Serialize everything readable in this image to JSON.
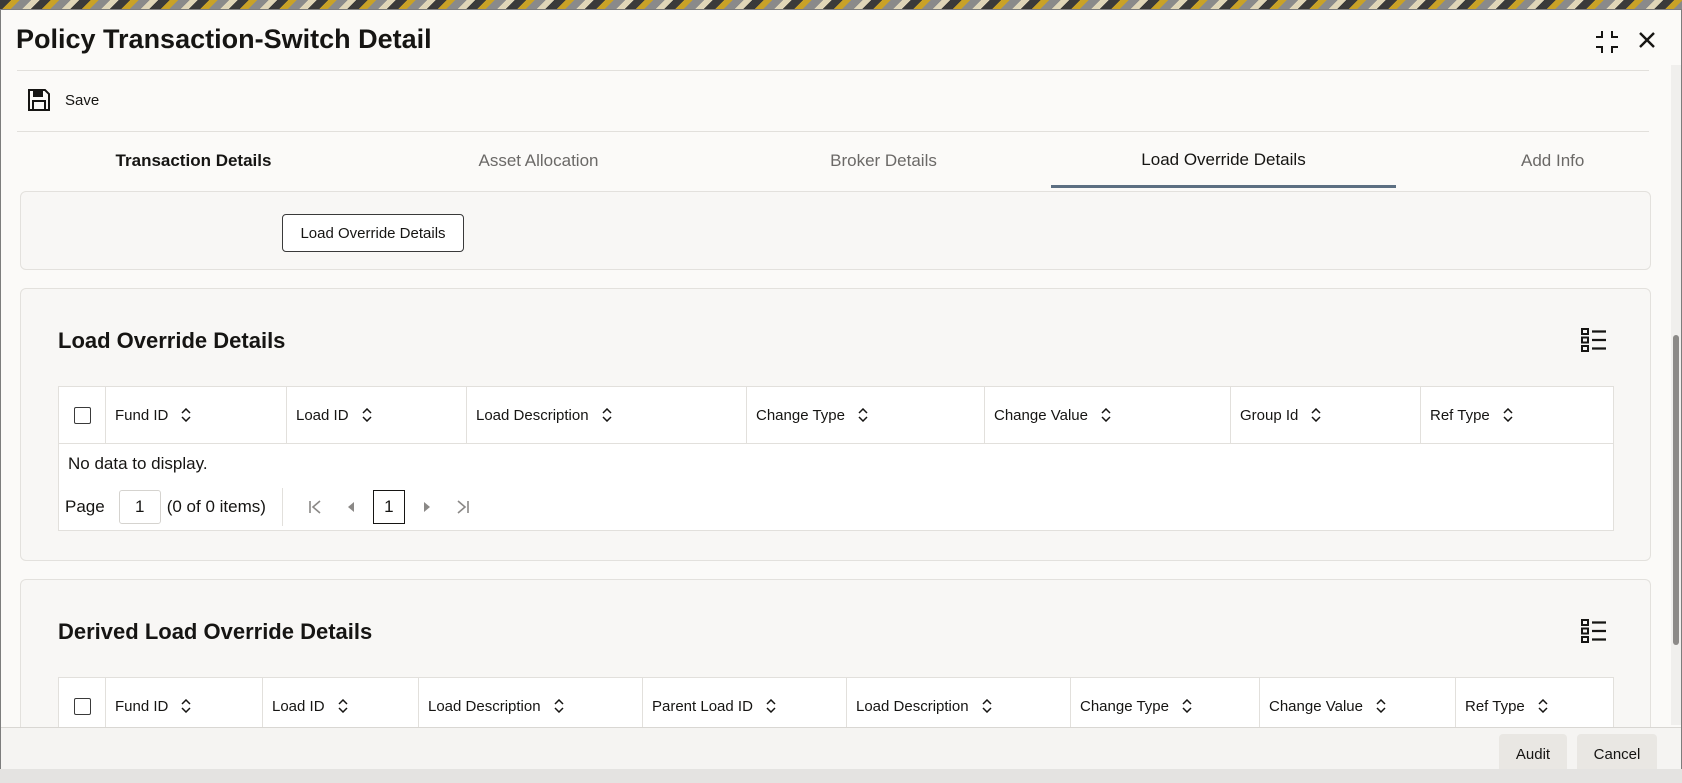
{
  "window": {
    "title": "Policy Transaction-Switch Detail"
  },
  "toolbar": {
    "save_label": "Save"
  },
  "tabs": [
    {
      "label": "Transaction Details"
    },
    {
      "label": "Asset Allocation"
    },
    {
      "label": "Broker Details"
    },
    {
      "label": "Load Override Details"
    },
    {
      "label": "Add Info"
    }
  ],
  "load_override_button": "Load Override Details",
  "section1": {
    "title": "Load Override Details",
    "columns": [
      "Fund ID",
      "Load ID",
      "Load Description",
      "Change Type",
      "Change Value",
      "Group Id",
      "Ref Type"
    ],
    "empty_text": "No data to display.",
    "pager": {
      "label": "Page",
      "page": "1",
      "items_text": "(0 of 0 items)",
      "current": "1"
    }
  },
  "section2": {
    "title": "Derived Load Override Details",
    "columns": [
      "Fund ID",
      "Load ID",
      "Load Description",
      "Parent Load ID",
      "Load Description",
      "Change Type",
      "Change Value",
      "Ref Type"
    ]
  },
  "footer": {
    "audit_label": "Audit",
    "cancel_label": "Cancel"
  }
}
